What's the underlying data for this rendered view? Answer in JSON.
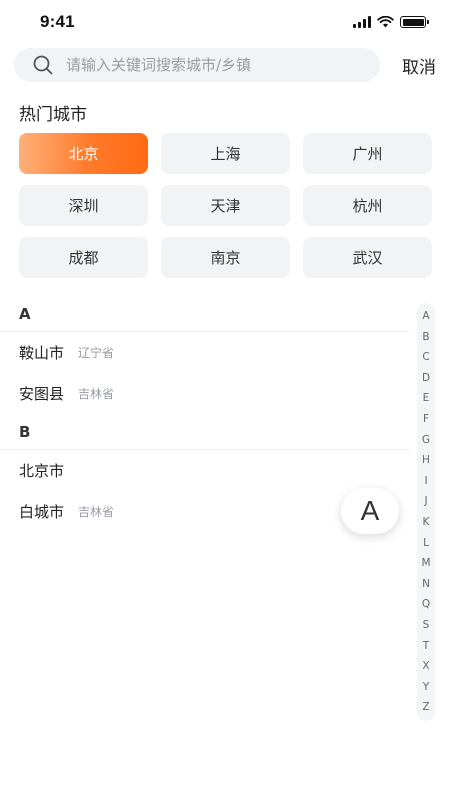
{
  "status_bar": {
    "time": "9:41"
  },
  "search": {
    "placeholder": "请输入关键词搜索城市/乡镇",
    "value": "",
    "cancel_label": "取消"
  },
  "hot_cities": {
    "title": "热门城市",
    "items": [
      "北京",
      "上海",
      "广州",
      "深圳",
      "天津",
      "杭州",
      "成都",
      "南京",
      "武汉"
    ],
    "selected": "北京"
  },
  "city_groups": [
    {
      "letter": "A",
      "cities": [
        {
          "name": "鞍山市",
          "province": "辽宁省"
        },
        {
          "name": "安图县",
          "province": "吉林省"
        }
      ]
    },
    {
      "letter": "B",
      "cities": [
        {
          "name": "北京市",
          "province": ""
        },
        {
          "name": "白城市",
          "province": "吉林省"
        }
      ]
    }
  ],
  "index_letters": [
    "A",
    "B",
    "C",
    "D",
    "E",
    "F",
    "G",
    "H",
    "I",
    "J",
    "K",
    "L",
    "M",
    "N",
    "Q",
    "S",
    "T",
    "X",
    "Y",
    "Z"
  ],
  "current_letter": "A",
  "colors": {
    "accent_start": "#ffb07a",
    "accent_end": "#ff6a14",
    "chip_bg": "#f2f3f5"
  }
}
